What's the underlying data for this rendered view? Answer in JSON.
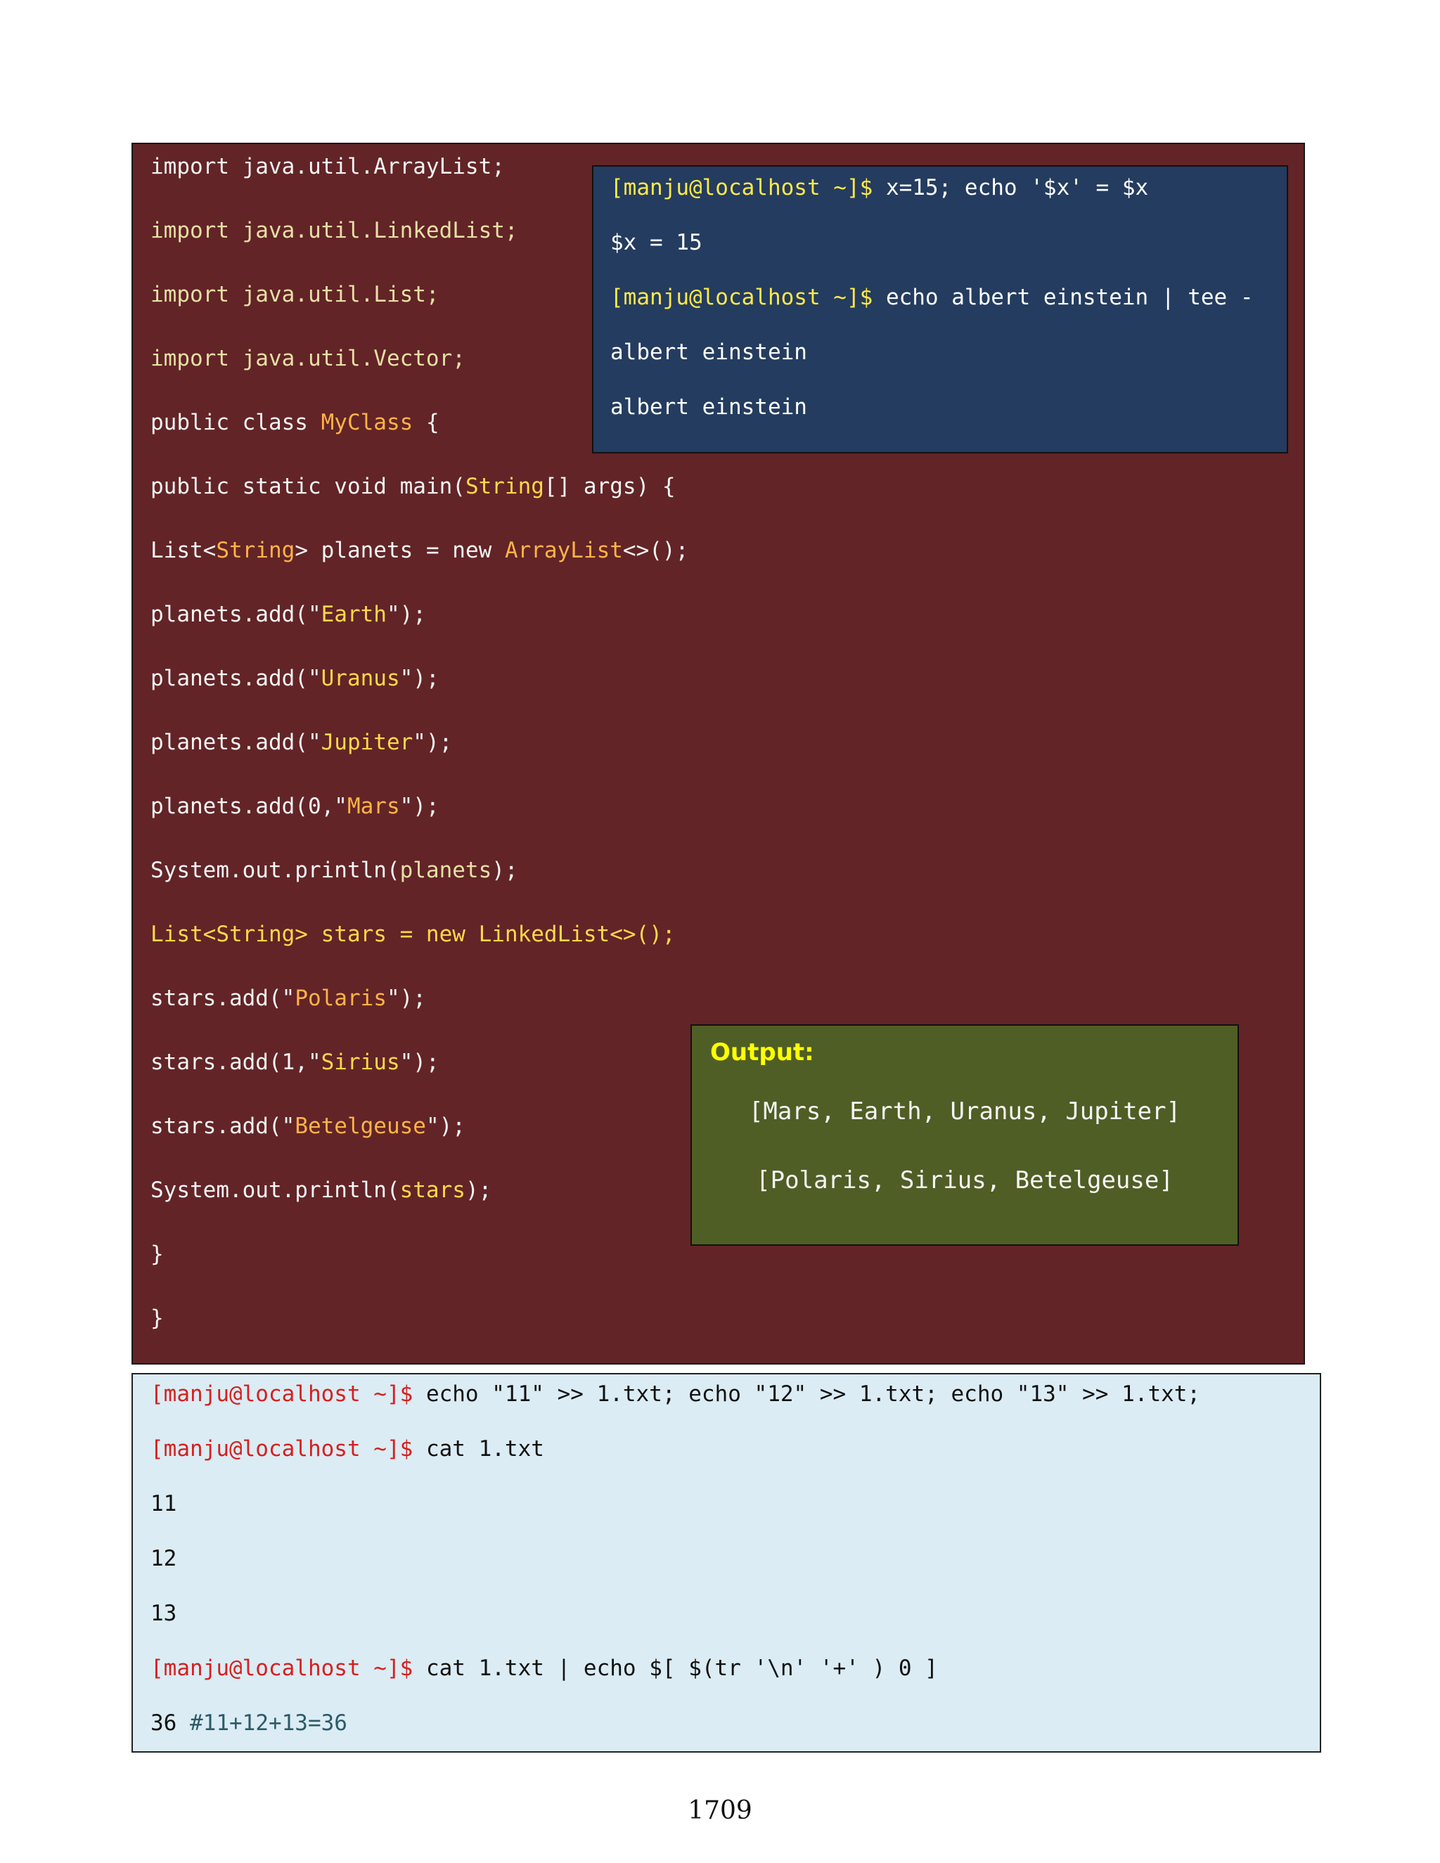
{
  "code_lines": [
    "import java.util.ArrayList;",
    "import java.util.LinkedList;",
    "import java.util.List;",
    "import java.util.Vector;",
    "public class ",
    "MyClass",
    " {",
    "public static void main(",
    "String",
    "[] args) {",
    "List<",
    "String",
    "> planets = new ",
    "ArrayList",
    "<>();",
    "planets.add(\"",
    "Earth",
    "\");",
    "planets.add(\"",
    "Uranus",
    "\");",
    "planets.add(\"",
    "Jupiter",
    "\");",
    "planets.add(0,\"",
    "Mars",
    "\");",
    "System.out.println(",
    "planets",
    ");",
    "List<String> stars = new LinkedList<>();",
    "stars.add(\"",
    "Polaris",
    "\");",
    "stars.add(1,\"",
    "Sirius",
    "\");",
    "stars.add(\"",
    "Betelgeuse",
    "\");",
    "System.out.println(",
    "stars",
    ");",
    "}",
    "}"
  ],
  "terminal_top": {
    "prompt": "[manju@localhost ~]$",
    "cmd1": " x=15; echo '$x' = $x",
    "out1": "$x = 15",
    "cmd2": " echo albert einstein | tee -",
    "out2": "albert einstein",
    "out3": "albert einstein"
  },
  "output_box": {
    "title": "Output:",
    "line1": "[Mars, Earth, Uranus, Jupiter]",
    "line2": "[Polaris, Sirius, Betelgeuse]"
  },
  "terminal_bottom": {
    "prompt": "[manju@localhost ~]$",
    "cmd1": " echo \"11\" >> 1.txt; echo \"12\" >> 1.txt; echo \"13\" >> 1.txt;",
    "cmd2": " cat 1.txt",
    "out1": "11",
    "out2": "12",
    "out3": "13",
    "cmd3": " cat 1.txt | echo $[ $(tr '\\n' '+' ) 0 ]",
    "result": "36 ",
    "comment": "#11+12+13=36"
  },
  "page_number": "1709",
  "colors": {
    "code_panel": "#622427",
    "terminal_top": "#243c5f",
    "output_box": "#4f5e25",
    "terminal_bottom": "#dbecf4"
  }
}
